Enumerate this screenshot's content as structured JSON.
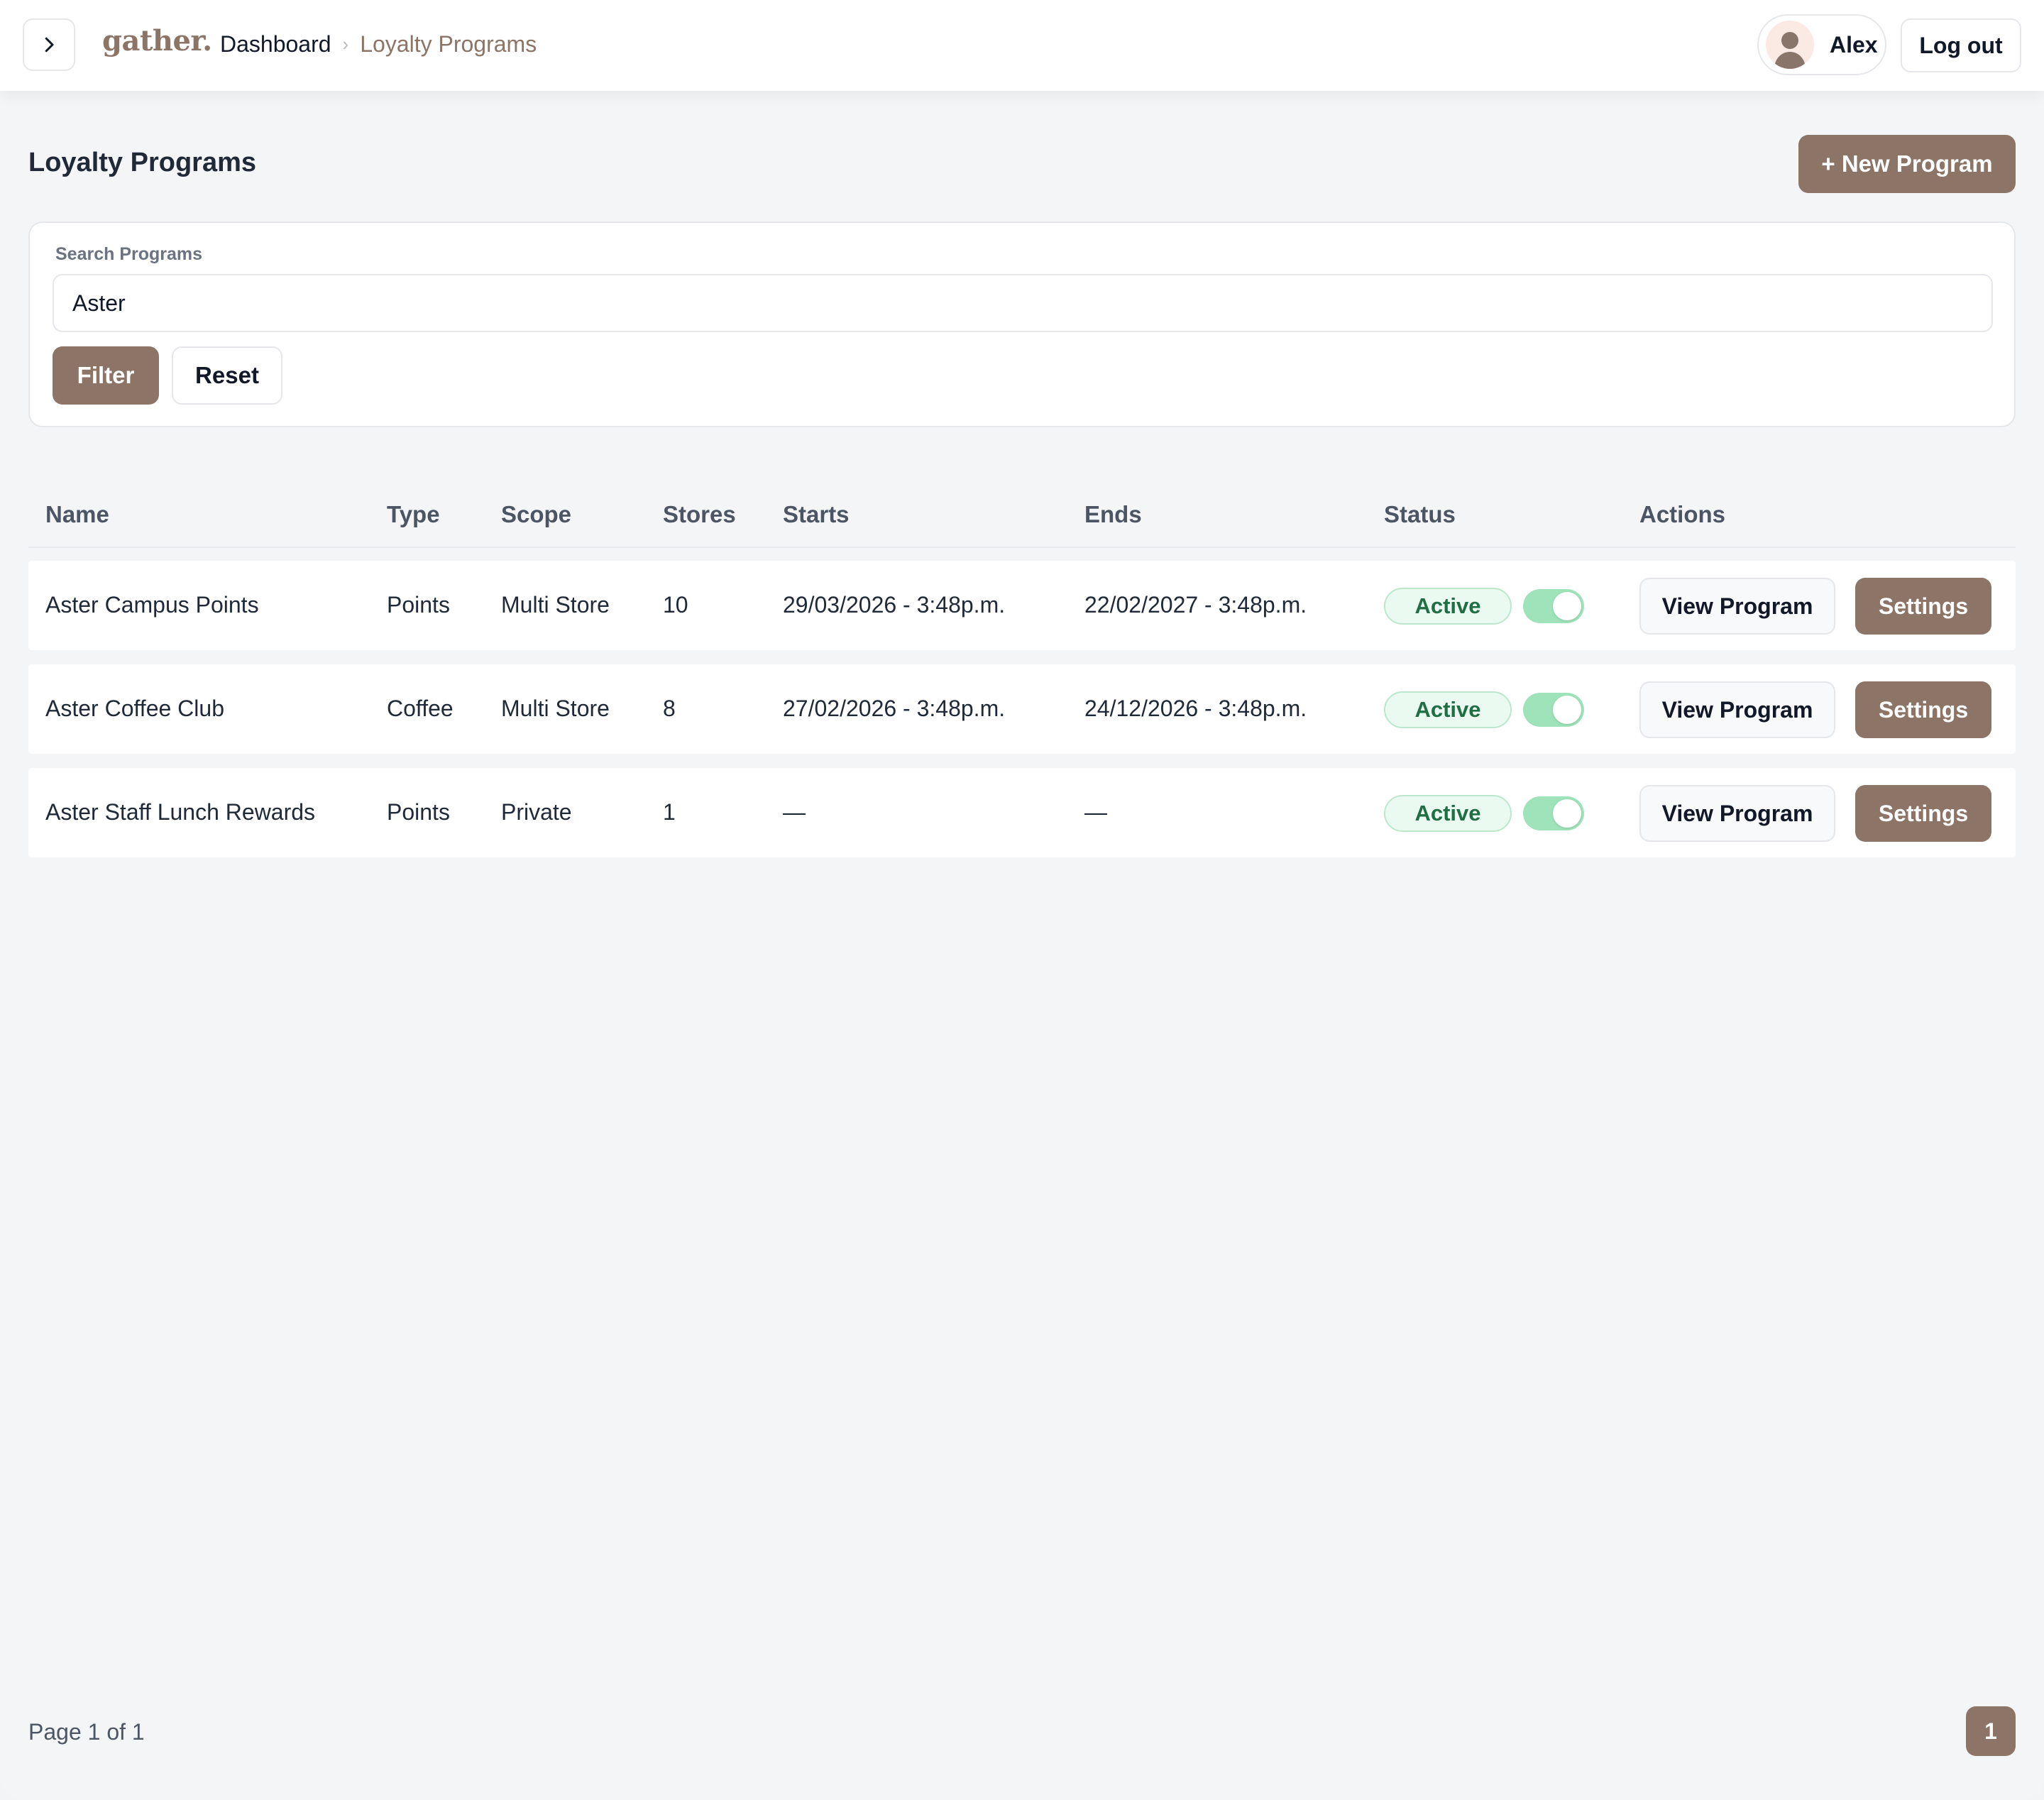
{
  "header": {
    "logo": "gather.",
    "breadcrumb": {
      "home": "Dashboard",
      "separator": "›",
      "current": "Loyalty Programs"
    },
    "user": {
      "name": "Alex"
    },
    "logout_label": "Log out"
  },
  "page": {
    "title": "Loyalty Programs",
    "new_button_label": "+ New Program"
  },
  "filter": {
    "label": "Search Programs",
    "search_value": "Aster",
    "filter_label": "Filter",
    "reset_label": "Reset"
  },
  "table": {
    "columns": [
      "Name",
      "Type",
      "Scope",
      "Stores",
      "Starts",
      "Ends",
      "Status",
      "Actions"
    ],
    "rows": [
      {
        "name": "Aster Campus Points",
        "type": "Points",
        "scope": "Multi Store",
        "stores": "10",
        "starts": "29/03/2026 - 3:48p.m.",
        "ends": "22/02/2027 - 3:48p.m.",
        "status": "Active",
        "enabled": true,
        "view_label": "View Program",
        "settings_label": "Settings"
      },
      {
        "name": "Aster Coffee Club",
        "type": "Coffee",
        "scope": "Multi Store",
        "stores": "8",
        "starts": "27/02/2026 - 3:48p.m.",
        "ends": "24/12/2026 - 3:48p.m.",
        "status": "Active",
        "enabled": true,
        "view_label": "View Program",
        "settings_label": "Settings"
      },
      {
        "name": "Aster Staff Lunch Rewards",
        "type": "Points",
        "scope": "Private",
        "stores": "1",
        "starts": "—",
        "ends": "—",
        "status": "Active",
        "enabled": true,
        "view_label": "View Program",
        "settings_label": "Settings"
      }
    ]
  },
  "pagination": {
    "info": "Page 1 of 1",
    "current_page": "1"
  },
  "colors": {
    "brand": "#8c7466",
    "active_badge_bg": "#ebfaf0",
    "active_text": "#1f6e44",
    "toggle_on": "#9fe3bb"
  },
  "icons": {
    "nav_toggle": "chevron-right-icon",
    "avatar": "user-icon"
  }
}
